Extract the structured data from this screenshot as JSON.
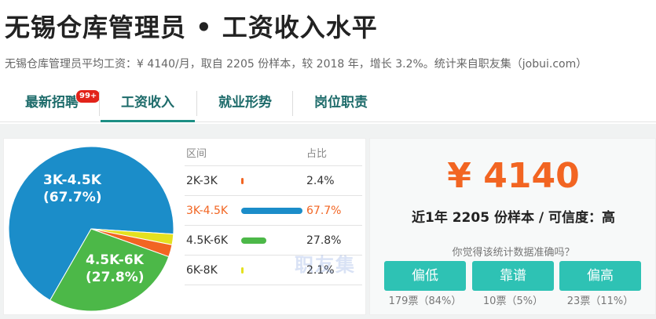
{
  "header": {
    "title": "无锡仓库管理员 • 工资收入水平",
    "subtitle": "无锡仓库管理员平均工资：¥ 4140/月，取自 2205 份样本，较 2018 年，增长 3.2%。统计来自职友集（jobui.com）"
  },
  "tabs": [
    {
      "label": "最新招聘",
      "badge": "99+"
    },
    {
      "label": "工资收入"
    },
    {
      "label": "就业形势"
    },
    {
      "label": "岗位职责"
    }
  ],
  "distribution": {
    "col_range": "区间",
    "col_pct": "占比",
    "rows": [
      {
        "range": "2K-3K",
        "pct": "2.4%"
      },
      {
        "range": "3K-4.5K",
        "pct": "67.7%"
      },
      {
        "range": "4.5K-6K",
        "pct": "27.8%"
      },
      {
        "range": "6K-8K",
        "pct": "2.1%"
      }
    ]
  },
  "chart_data": {
    "type": "pie",
    "categories": [
      "2K-3K",
      "3K-4.5K",
      "4.5K-6K",
      "6K-8K"
    ],
    "values": [
      2.4,
      67.7,
      27.8,
      2.1
    ],
    "colors": [
      "#f26522",
      "#1b8dc9",
      "#4cb848",
      "#e4e11f"
    ],
    "labels": [
      {
        "range": "3K-4.5K",
        "pct": "(67.7%)"
      },
      {
        "range": "4.5K-6K",
        "pct": "(27.8%)"
      }
    ]
  },
  "watermark": "职友集",
  "summary": {
    "salary": "¥ 4140",
    "sample_line": "近1年 2205 份样本 / 可信度：高",
    "question": "你觉得该统计数据准确吗？"
  },
  "votes": [
    {
      "label": "偏低",
      "count": "179票（84%）"
    },
    {
      "label": "靠谱",
      "count": "10票（5%）"
    },
    {
      "label": "偏高",
      "count": "23票（11%）"
    }
  ],
  "colors": {
    "accent": "#f26522",
    "teal": "#2ec2b4",
    "tab_text": "#1d6b6a"
  }
}
